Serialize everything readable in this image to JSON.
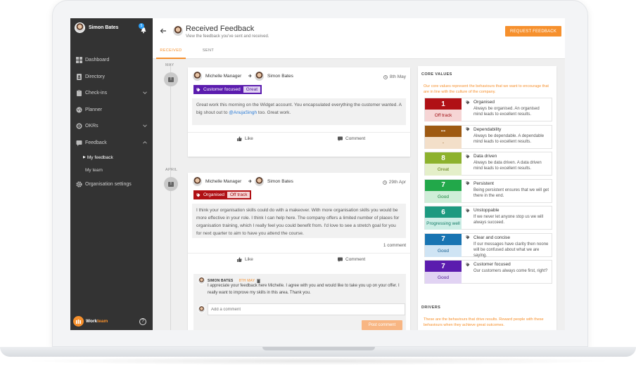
{
  "sidebar": {
    "user_name": "Simon Bates",
    "notification_count": "5",
    "items": [
      {
        "label": "Dashboard"
      },
      {
        "label": "Directory"
      },
      {
        "label": "Check-ins"
      },
      {
        "label": "Planner"
      },
      {
        "label": "OKRs"
      },
      {
        "label": "Feedback"
      },
      {
        "label": "Organisation settings"
      }
    ],
    "sub_items": [
      {
        "label": "My feedback"
      },
      {
        "label": "My team"
      }
    ],
    "logo_part1": "Work",
    "logo_part2": "team",
    "help": "?"
  },
  "header": {
    "title": "Received Feedback",
    "subtitle": "View the feedback you've sent and received.",
    "request_button": "REQUEST FEEDBACK",
    "tabs": [
      {
        "label": "RECEIVED"
      },
      {
        "label": "SENT"
      }
    ]
  },
  "feed": {
    "months": [
      "MAY",
      "APRIL"
    ],
    "cards": [
      {
        "from": "Michelle Manager",
        "to": "Simon Bates",
        "date": "8th May",
        "tag": "Customer focused",
        "status": "Great",
        "message_pre": "Great work this morning on the Widget account. You encapsulated everything the customer wanted. A big shout out to ",
        "mention": "@AnujaSingh",
        "message_post": " too. Great work.",
        "like": "Like",
        "comment": "Comment"
      },
      {
        "from": "Michelle Manager",
        "to": "Simon Bates",
        "date": "29th Apr",
        "tag": "Organised",
        "status": "Off track",
        "message": "I think your organisation skills could do with a makeover. With more organisation skills you would be more effective in your role. I think I can help here. The company offers a limited number of places for organisation training, which I really feel you could benefit from. I'd love to see a stretch goal for you for next quarter to aim to have you attend the course.",
        "comment_count": "1 comment",
        "like": "Like",
        "comment": "Comment",
        "reply": {
          "name": "SIMON BATES",
          "date": "8TH MAY",
          "text": "I appreciate your feedback here Michelle. I agree with you and would like to take you up on your offer. I really want to improve my skills in this area. Thank you."
        },
        "comment_placeholder": "Add a comment",
        "post_button": "Post comment"
      }
    ]
  },
  "core_values": {
    "heading": "CORE VALUES",
    "description": "Our core values represent the behaviours that we want to encourage that are in line with the culture of the company.",
    "items": [
      {
        "score": "1",
        "label": "Off track",
        "title": "Organised",
        "desc": "Always be organised. An organised mind leads to excellent results.",
        "color": "#b01015",
        "label_bg": "#f6d5d5",
        "label_color": "#a00d12"
      },
      {
        "score": "--",
        "label": "-",
        "title": "Dependability",
        "desc": "Always be dependable. A dependable mind leads to excellent results.",
        "color": "#9e5a12",
        "label_bg": "#f3dfc9",
        "label_color": "#8a4d0e"
      },
      {
        "score": "8",
        "label": "Great",
        "title": "Data driven",
        "desc": "Always be data driven. A data driven mind leads to excellent results.",
        "color": "#8db22d",
        "label_bg": "#e4efc9",
        "label_color": "#5f7d12"
      },
      {
        "score": "7",
        "label": "Good",
        "title": "Persistent",
        "desc": "Being persistent ensures that we will get there in the end.",
        "color": "#22a84a",
        "label_bg": "#cfeed8",
        "label_color": "#16823a"
      },
      {
        "score": "6",
        "label": "Progressing well",
        "title": "Unstoppable",
        "desc": "If we never let anyone stop us we will always succeed.",
        "color": "#1c9a80",
        "label_bg": "#cdeee6",
        "label_color": "#127a65"
      },
      {
        "score": "7",
        "label": "Good",
        "title": "Clear and concise",
        "desc": "If our messages have clarity then noone will be confused about what we are saying.",
        "color": "#1874b2",
        "label_bg": "#cfe4f4",
        "label_color": "#125c8e"
      },
      {
        "score": "7",
        "label": "Good",
        "title": "Customer focused",
        "desc": "Our customers always come first, right?",
        "color": "#5b1cae",
        "label_bg": "#e1d3f3",
        "label_color": "#4b1692"
      }
    ]
  },
  "drivers": {
    "heading": "DRIVERS",
    "description": "These are the behaviours that drive results. Reward people with these behaviours when they achieve great outcomes."
  },
  "colors": {
    "accent": "#f6902d",
    "sidebar_bg": "#333333",
    "customer_focused": "#5b1cae",
    "organised": "#b01015"
  }
}
